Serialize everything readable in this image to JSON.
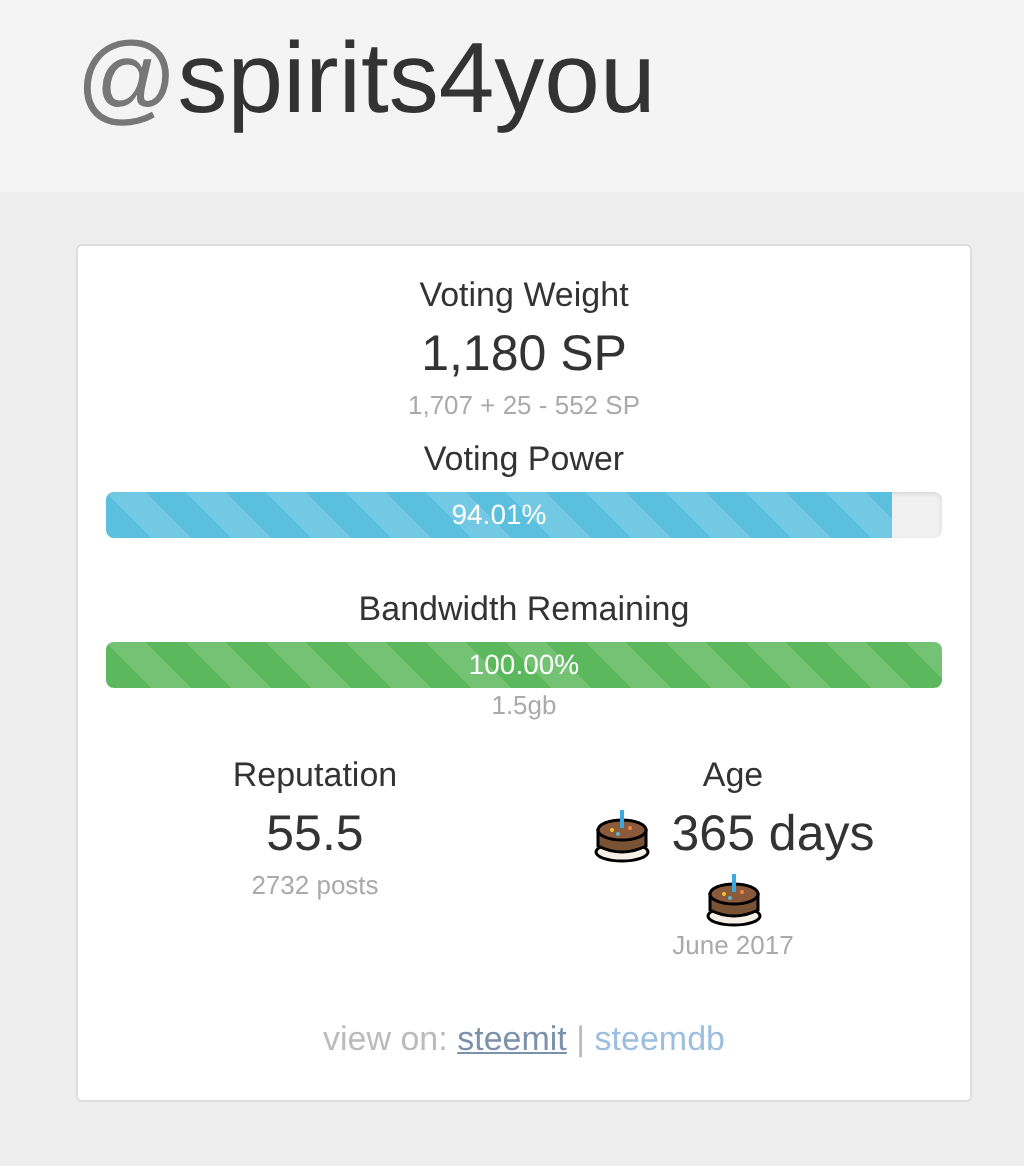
{
  "header": {
    "prefix": "@",
    "username": "spirits4you"
  },
  "voting_weight": {
    "label": "Voting Weight",
    "value": "1,180 SP",
    "breakdown": "1,707 + 25 - 552 SP"
  },
  "bars": [
    {
      "label": "Voting Power",
      "reading": "94.01%",
      "level": 0.9401,
      "color": "#5bc0de"
    },
    {
      "label": "Bandwidth Remaining",
      "reading": "100.00%",
      "level": 1.0,
      "color": "#5cb85c",
      "note": "1.5gb"
    }
  ],
  "reputation": {
    "label": "Reputation",
    "value": "55.5",
    "note": "2732 posts"
  },
  "age": {
    "label": "Age",
    "value": "365 days",
    "note": "June 2017"
  },
  "footer": {
    "prefix": "view on:",
    "links": [
      {
        "label": "steemit",
        "visited": true
      },
      {
        "label": "steemdb",
        "visited": false
      }
    ],
    "separator": "|"
  }
}
